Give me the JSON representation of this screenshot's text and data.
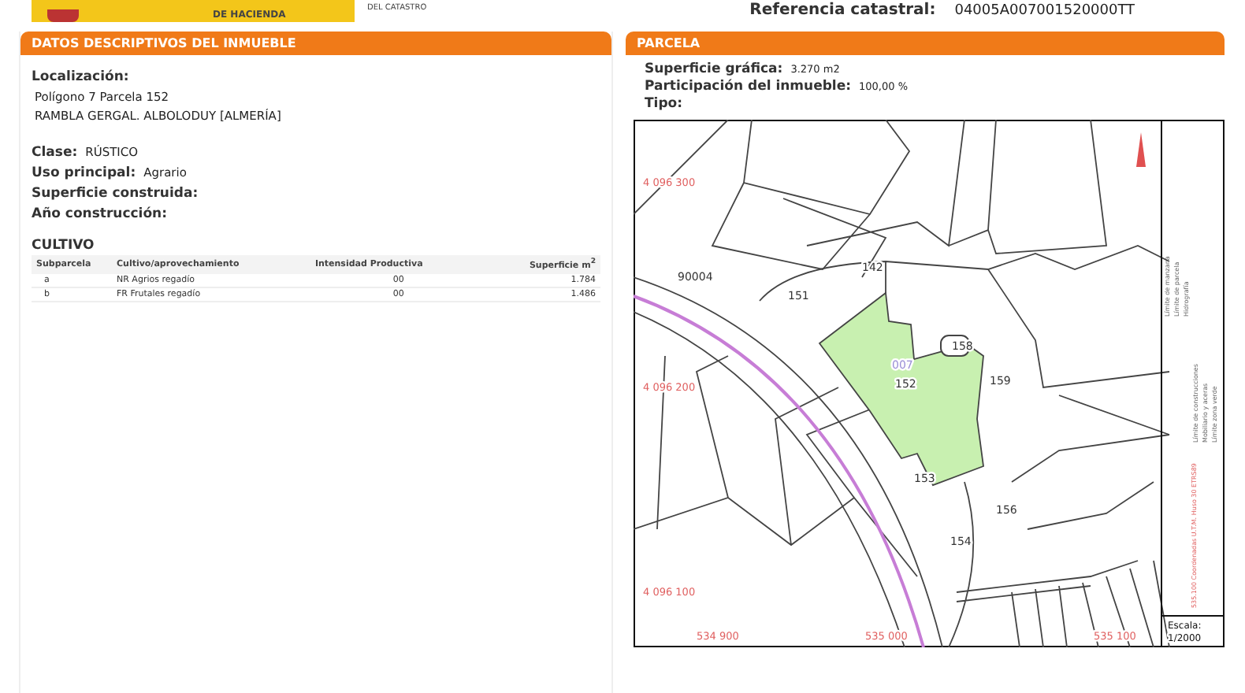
{
  "header": {
    "agency_line": "DE HACIENDA",
    "office_line": "DEL CATASTRO",
    "reference_label": "Referencia catastral:",
    "reference_value": "04005A007001520000TT"
  },
  "property": {
    "title": "DATOS DESCRIPTIVOS DEL INMUEBLE",
    "location_label": "Localización:",
    "location_lines": [
      "Polígono 7 Parcela 152",
      "RAMBLA GERGAL. ALBOLODUY [ALMERÍA]"
    ],
    "fields": [
      {
        "label": "Clase:",
        "value": "RÚSTICO"
      },
      {
        "label": "Uso principal:",
        "value": "Agrario"
      },
      {
        "label": "Superficie construida:"
      },
      {
        "label": "Año construcción:"
      }
    ],
    "crop_title": "CULTIVO",
    "crop_columns": [
      "Subparcela",
      "Cultivo/aprovechamiento",
      "Intensidad Productiva",
      "Superficie m$^{2}$"
    ],
    "crop_rows": [
      [
        "a",
        "NR Agrios regadío",
        "00",
        "1.784"
      ],
      [
        "b",
        "FR Frutales regadío",
        "00",
        "1.486"
      ]
    ]
  },
  "parcel": {
    "title": "PARCELA",
    "fields": [
      {
        "label": "Superficie gráfica:",
        "value": "3.270 m2"
      },
      {
        "label": "Participación del inmueble:",
        "value": "100,00 %"
      },
      {
        "label": "Tipo:"
      }
    ],
    "map": {
      "northing_labels": [
        "4 096 300",
        "4 096 200",
        "4 096 100"
      ],
      "easting_labels": [
        "534 900",
        "535 000",
        "535 100"
      ],
      "parcel_labels": [
        "90004",
        "151",
        "142",
        "158",
        "007",
        "152",
        "159",
        "153",
        "156",
        "154"
      ],
      "legend": [
        "Límite de manzana",
        "Límite de parcela",
        "Hidrografía",
        "Límite de construcciones",
        "Mobiliario y aceras",
        "Límite zona verde"
      ],
      "coordinates_note": "535.100 Coordenadas U.T.M. Huso 30 ETRS89",
      "scale_label": "Escala:",
      "scale_value": "1/2000"
    }
  }
}
